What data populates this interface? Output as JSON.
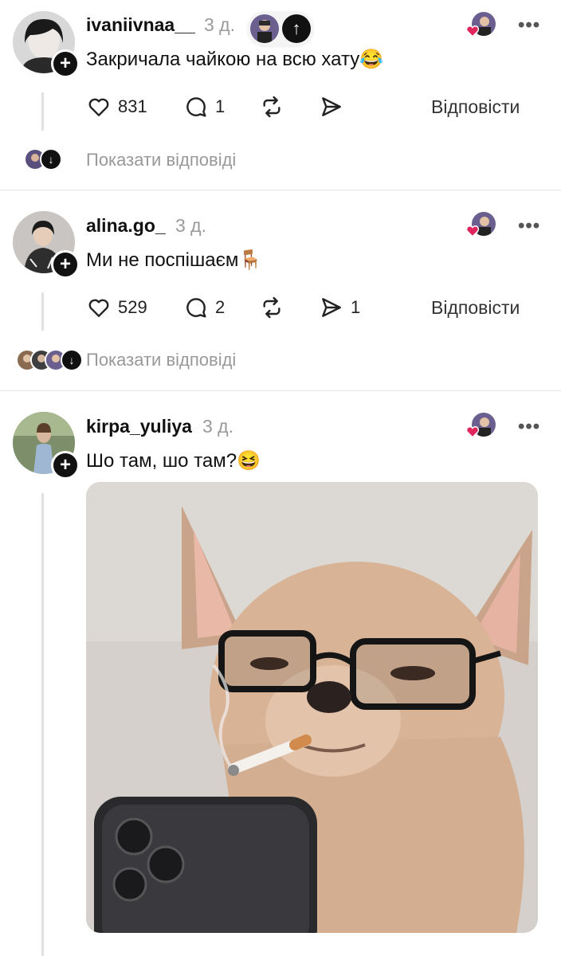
{
  "posts": [
    {
      "username": "ivaniivnaa__",
      "time": "3 д.",
      "text": "Закричала чайкою на всю хату😂",
      "likes": "831",
      "comments": "1",
      "shares": "",
      "reply_label": "Відповісти",
      "show_replies": "Показати відповіді"
    },
    {
      "username": "alina.go_",
      "time": "3 д.",
      "text": "Ми не поспішаєм🪑",
      "likes": "529",
      "comments": "2",
      "shares": "1",
      "reply_label": "Відповісти",
      "show_replies": "Показати відповіді"
    },
    {
      "username": "kirpa_yuliya",
      "time": "3 д.",
      "text": "Шо там, шо там?😆"
    }
  ],
  "more_label": "•••",
  "icons": {
    "like": "heart-icon",
    "comment": "comment-icon",
    "repost": "repost-icon",
    "share": "send-icon",
    "follow": "plus-icon",
    "scroll_up": "arrow-up-icon"
  },
  "colors": {
    "accent": "#111111",
    "muted": "#9a9a9a",
    "heart": "#e0245e"
  }
}
